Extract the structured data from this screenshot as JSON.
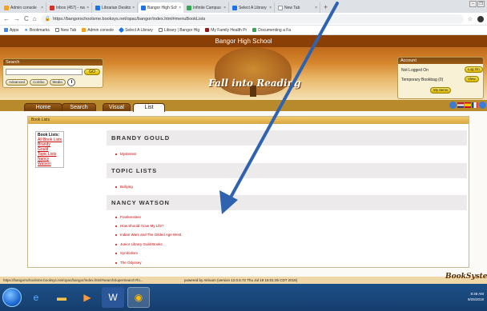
{
  "browser": {
    "tabs": [
      {
        "label": "Admin console",
        "color": "#f4a21d"
      },
      {
        "label": "Inbox (457) - rwatso",
        "color": "#d93025"
      },
      {
        "label": "Librarian Desktop",
        "color": "#1a73e8"
      },
      {
        "label": "Bangor High School",
        "color": "#1a73e8"
      },
      {
        "label": "Infinite Campus",
        "color": "#34a853"
      },
      {
        "label": "Select A Library",
        "color": "#1a73e8"
      },
      {
        "label": "New Tab",
        "color": "#ffffff"
      }
    ],
    "url": "https://bangorschoolsme.booksys.net/opac/bangor/index.html#menuBookLists",
    "bookmarks": [
      "Apps",
      "Bookmarks",
      "New Tab",
      "Admin console",
      "Select A Library",
      "Library | Bangor Hig",
      "My Family Health Pr",
      "Documenting a Fa"
    ]
  },
  "site": {
    "title": "Bangor High School",
    "banner_text": "Fall into Reading",
    "search": {
      "heading": "Search",
      "go": "GO",
      "buttons": [
        "Advanced",
        "Combo",
        "Media"
      ]
    },
    "account": {
      "heading": "Account",
      "status": "Not Logged On",
      "bookbag": "Temporary Bookbag (0)",
      "login": "Log On",
      "view": "View",
      "my_items": "My Items"
    },
    "tabs": [
      "Home",
      "Search",
      "Visual",
      "List"
    ],
    "book_lists": {
      "heading": "Book Lists",
      "toc_title": "Book Lists:",
      "toc_links": [
        "All Book Lists",
        "Brandy Gould",
        "Topic Lists",
        "Nancy Watson"
      ],
      "sections": [
        {
          "title": "BRANDY GOULD",
          "items": [
            "Mysteries!"
          ]
        },
        {
          "title": "TOPIC LISTS",
          "items": [
            "Bullying"
          ]
        },
        {
          "title": "NANCY WATSON",
          "items": [
            "Frankenstein",
            "How Should I Live My Life?",
            "Indian Wars and The Gilded Age West",
            "Junior Library Guild Books",
            "Symbolism",
            "The Odyssey"
          ]
        }
      ]
    },
    "status_url": "https://bangorschoolsme.booksys.net/opac/bangor/index.html#searchSuperSearch?fo...",
    "powered_by": "powered by Atriuum (version 12.0.6.72 Thu Jul 19 15:01:35 CDT 2018)",
    "footer_logo": "BookSystems"
  },
  "taskbar": {
    "time": "8:48 AM",
    "date": "9/25/2018"
  }
}
